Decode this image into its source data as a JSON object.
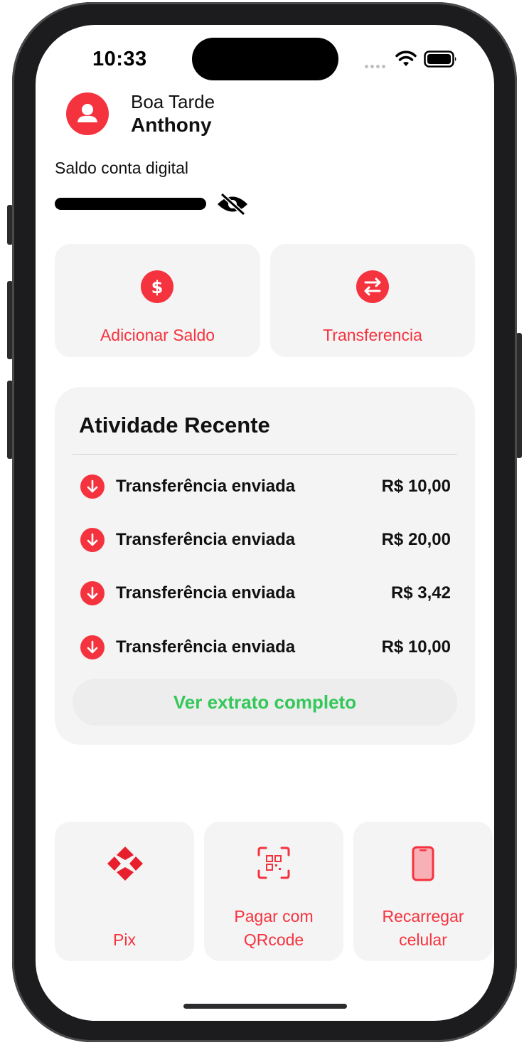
{
  "status_bar": {
    "time": "10:33"
  },
  "header": {
    "greeting": "Boa Tarde",
    "user_name": "Anthony"
  },
  "balance": {
    "label": "Saldo conta digital",
    "hidden": true
  },
  "quick_actions": [
    {
      "label": "Adicionar Saldo",
      "icon": "dollar-icon"
    },
    {
      "label": "Transferencia",
      "icon": "transfer-arrows-icon"
    }
  ],
  "activity": {
    "title": "Atividade Recente",
    "items": [
      {
        "description": "Transferência enviada",
        "amount": "R$ 10,00"
      },
      {
        "description": "Transferência enviada",
        "amount": "R$ 20,00"
      },
      {
        "description": "Transferência enviada",
        "amount": "R$ 3,42"
      },
      {
        "description": "Transferência enviada",
        "amount": "R$ 10,00"
      }
    ],
    "statement_button": "Ver extrato completo"
  },
  "shortcuts": [
    {
      "line1": "Pix",
      "line2": "",
      "icon": "pix-icon"
    },
    {
      "line1": "Pagar com",
      "line2": "QRcode",
      "icon": "qrcode-scan-icon"
    },
    {
      "line1": "Recarregar",
      "line2": "celular",
      "icon": "mobile-phone-icon"
    }
  ],
  "colors": {
    "accent": "#f5333f",
    "success": "#34c759",
    "card_bg": "#f4f4f4"
  }
}
